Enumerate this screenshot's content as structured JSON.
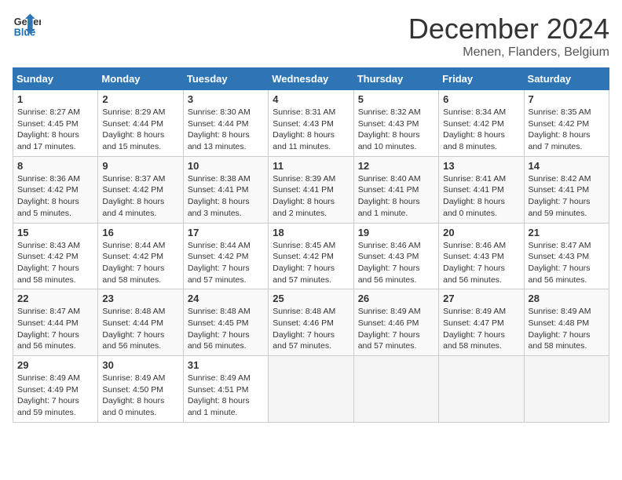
{
  "logo": {
    "line1": "General",
    "line2": "Blue"
  },
  "title": "December 2024",
  "location": "Menen, Flanders, Belgium",
  "days_of_week": [
    "Sunday",
    "Monday",
    "Tuesday",
    "Wednesday",
    "Thursday",
    "Friday",
    "Saturday"
  ],
  "weeks": [
    [
      {
        "day": "1",
        "sunrise": "8:27 AM",
        "sunset": "4:45 PM",
        "daylight": "8 hours and 17 minutes."
      },
      {
        "day": "2",
        "sunrise": "8:29 AM",
        "sunset": "4:44 PM",
        "daylight": "8 hours and 15 minutes."
      },
      {
        "day": "3",
        "sunrise": "8:30 AM",
        "sunset": "4:44 PM",
        "daylight": "8 hours and 13 minutes."
      },
      {
        "day": "4",
        "sunrise": "8:31 AM",
        "sunset": "4:43 PM",
        "daylight": "8 hours and 11 minutes."
      },
      {
        "day": "5",
        "sunrise": "8:32 AM",
        "sunset": "4:43 PM",
        "daylight": "8 hours and 10 minutes."
      },
      {
        "day": "6",
        "sunrise": "8:34 AM",
        "sunset": "4:42 PM",
        "daylight": "8 hours and 8 minutes."
      },
      {
        "day": "7",
        "sunrise": "8:35 AM",
        "sunset": "4:42 PM",
        "daylight": "8 hours and 7 minutes."
      }
    ],
    [
      {
        "day": "8",
        "sunrise": "8:36 AM",
        "sunset": "4:42 PM",
        "daylight": "8 hours and 5 minutes."
      },
      {
        "day": "9",
        "sunrise": "8:37 AM",
        "sunset": "4:42 PM",
        "daylight": "8 hours and 4 minutes."
      },
      {
        "day": "10",
        "sunrise": "8:38 AM",
        "sunset": "4:41 PM",
        "daylight": "8 hours and 3 minutes."
      },
      {
        "day": "11",
        "sunrise": "8:39 AM",
        "sunset": "4:41 PM",
        "daylight": "8 hours and 2 minutes."
      },
      {
        "day": "12",
        "sunrise": "8:40 AM",
        "sunset": "4:41 PM",
        "daylight": "8 hours and 1 minute."
      },
      {
        "day": "13",
        "sunrise": "8:41 AM",
        "sunset": "4:41 PM",
        "daylight": "8 hours and 0 minutes."
      },
      {
        "day": "14",
        "sunrise": "8:42 AM",
        "sunset": "4:41 PM",
        "daylight": "7 hours and 59 minutes."
      }
    ],
    [
      {
        "day": "15",
        "sunrise": "8:43 AM",
        "sunset": "4:42 PM",
        "daylight": "7 hours and 58 minutes."
      },
      {
        "day": "16",
        "sunrise": "8:44 AM",
        "sunset": "4:42 PM",
        "daylight": "7 hours and 58 minutes."
      },
      {
        "day": "17",
        "sunrise": "8:44 AM",
        "sunset": "4:42 PM",
        "daylight": "7 hours and 57 minutes."
      },
      {
        "day": "18",
        "sunrise": "8:45 AM",
        "sunset": "4:42 PM",
        "daylight": "7 hours and 57 minutes."
      },
      {
        "day": "19",
        "sunrise": "8:46 AM",
        "sunset": "4:43 PM",
        "daylight": "7 hours and 56 minutes."
      },
      {
        "day": "20",
        "sunrise": "8:46 AM",
        "sunset": "4:43 PM",
        "daylight": "7 hours and 56 minutes."
      },
      {
        "day": "21",
        "sunrise": "8:47 AM",
        "sunset": "4:43 PM",
        "daylight": "7 hours and 56 minutes."
      }
    ],
    [
      {
        "day": "22",
        "sunrise": "8:47 AM",
        "sunset": "4:44 PM",
        "daylight": "7 hours and 56 minutes."
      },
      {
        "day": "23",
        "sunrise": "8:48 AM",
        "sunset": "4:44 PM",
        "daylight": "7 hours and 56 minutes."
      },
      {
        "day": "24",
        "sunrise": "8:48 AM",
        "sunset": "4:45 PM",
        "daylight": "7 hours and 56 minutes."
      },
      {
        "day": "25",
        "sunrise": "8:48 AM",
        "sunset": "4:46 PM",
        "daylight": "7 hours and 57 minutes."
      },
      {
        "day": "26",
        "sunrise": "8:49 AM",
        "sunset": "4:46 PM",
        "daylight": "7 hours and 57 minutes."
      },
      {
        "day": "27",
        "sunrise": "8:49 AM",
        "sunset": "4:47 PM",
        "daylight": "7 hours and 58 minutes."
      },
      {
        "day": "28",
        "sunrise": "8:49 AM",
        "sunset": "4:48 PM",
        "daylight": "7 hours and 58 minutes."
      }
    ],
    [
      {
        "day": "29",
        "sunrise": "8:49 AM",
        "sunset": "4:49 PM",
        "daylight": "7 hours and 59 minutes."
      },
      {
        "day": "30",
        "sunrise": "8:49 AM",
        "sunset": "4:50 PM",
        "daylight": "8 hours and 0 minutes."
      },
      {
        "day": "31",
        "sunrise": "8:49 AM",
        "sunset": "4:51 PM",
        "daylight": "8 hours and 1 minute."
      },
      null,
      null,
      null,
      null
    ]
  ]
}
